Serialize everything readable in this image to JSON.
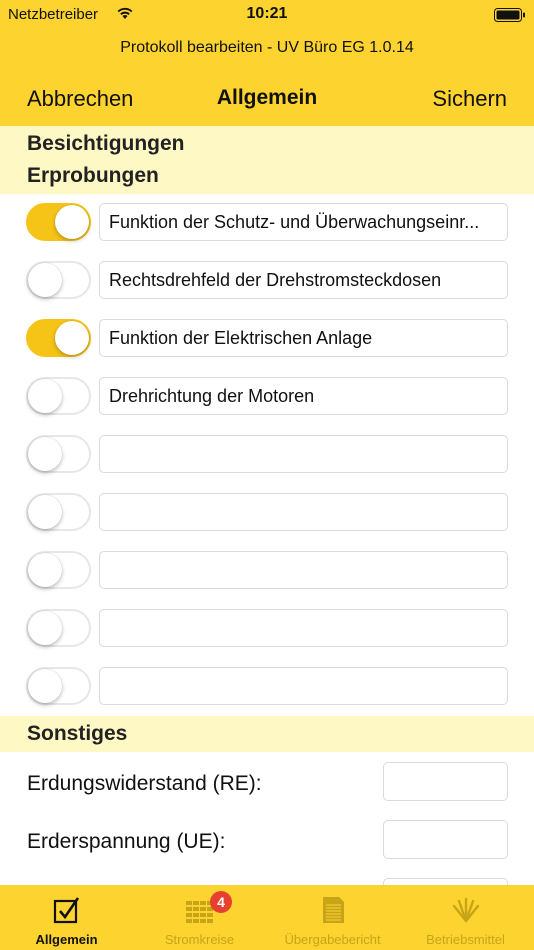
{
  "status_bar": {
    "carrier": "Netzbetreiber",
    "time": "10:21"
  },
  "header": {
    "subtitle": "Protokoll bearbeiten - UV Büro EG 1.0.14"
  },
  "nav": {
    "cancel_label": "Abbrechen",
    "title": "Allgemein",
    "save_label": "Sichern"
  },
  "sections": {
    "besichtigungen": "Besichtigungen",
    "erprobungen": "Erprobungen",
    "sonstiges": "Sonstiges"
  },
  "erprobungen_items": [
    {
      "on": true,
      "text": "Funktion der Schutz- und Überwachungseinr..."
    },
    {
      "on": false,
      "text": "Rechtsdrehfeld der Drehstromsteckdosen"
    },
    {
      "on": true,
      "text": "Funktion der Elektrischen Anlage"
    },
    {
      "on": false,
      "text": "Drehrichtung der Motoren"
    },
    {
      "on": false,
      "text": ""
    },
    {
      "on": false,
      "text": ""
    },
    {
      "on": false,
      "text": ""
    },
    {
      "on": false,
      "text": ""
    },
    {
      "on": false,
      "text": ""
    }
  ],
  "sonstiges_items": [
    {
      "label": "Erdungswiderstand (RE):",
      "value": ""
    },
    {
      "label": "Erderspannung (UE):",
      "value": ""
    }
  ],
  "tabs": [
    {
      "label": "Allgemein",
      "icon": "checkbox-icon",
      "active": true
    },
    {
      "label": "Stromkreise",
      "icon": "grid-icon",
      "active": false,
      "badge": "4"
    },
    {
      "label": "Übergabebericht",
      "icon": "document-icon",
      "active": false
    },
    {
      "label": "Betriebsmittel",
      "icon": "lamp-icon",
      "active": false
    }
  ],
  "colors": {
    "accent": "#fdd32f",
    "toggle_on": "#f6c417",
    "section_bg": "#fef8c4",
    "badge": "#e8402f"
  }
}
